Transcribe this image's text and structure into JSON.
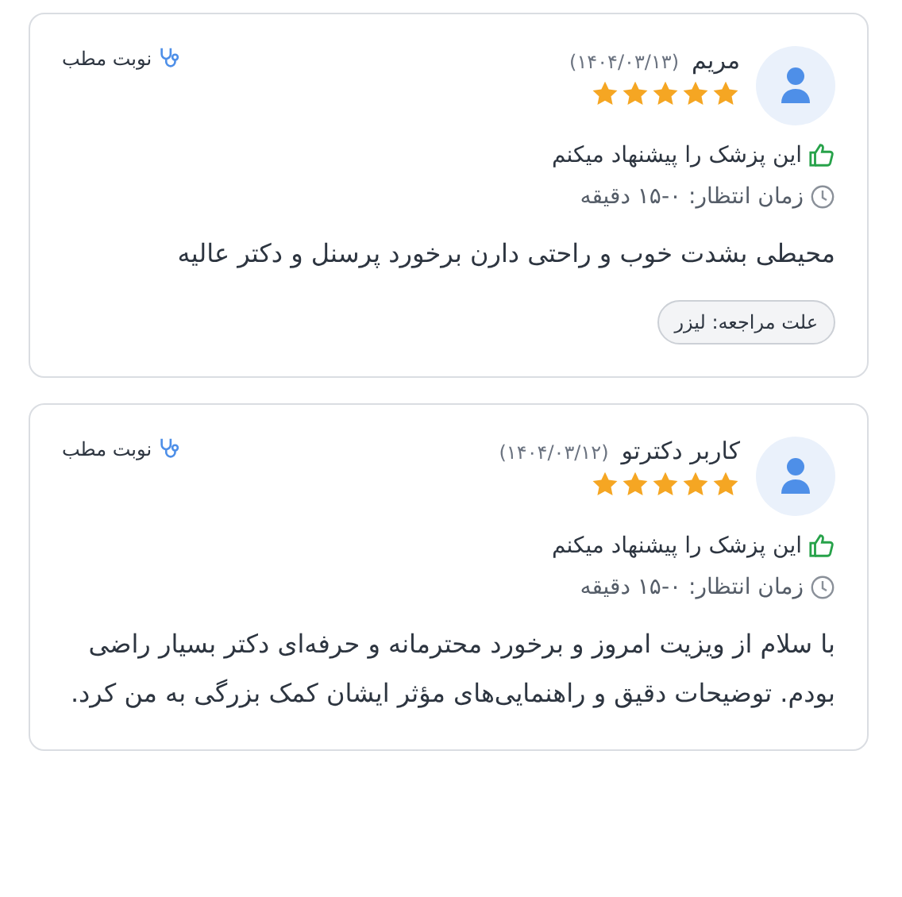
{
  "reviews": [
    {
      "name": "مریم",
      "date": "(۱۴۰۴/۰۳/۱۳)",
      "stars": 5,
      "recommendation": "این پزشک را پیشنهاد میکنم",
      "wait_time": "زمان انتظار: ۰-۱۵ دقیقه",
      "appointment_type": "نوبت مطب",
      "comment": "محیطی بشدت خوب و راحتی دارن برخورد پرسنل و دکتر عالیه",
      "visit_reason": "علت مراجعه: لیزر"
    },
    {
      "name": "کاربر دکترتو",
      "date": "(۱۴۰۴/۰۳/۱۲)",
      "stars": 5,
      "recommendation": "این پزشک را پیشنهاد میکنم",
      "wait_time": "زمان انتظار: ۰-۱۵ دقیقه",
      "appointment_type": "نوبت مطب",
      "comment": "با سلام از ویزیت امروز و برخورد محترمانه و حرفه‌ای دکتر بسیار راضی بودم. توضیحات دقیق و راهنمایی‌های مؤثر ایشان کمک بزرگی به من کرد."
    }
  ]
}
